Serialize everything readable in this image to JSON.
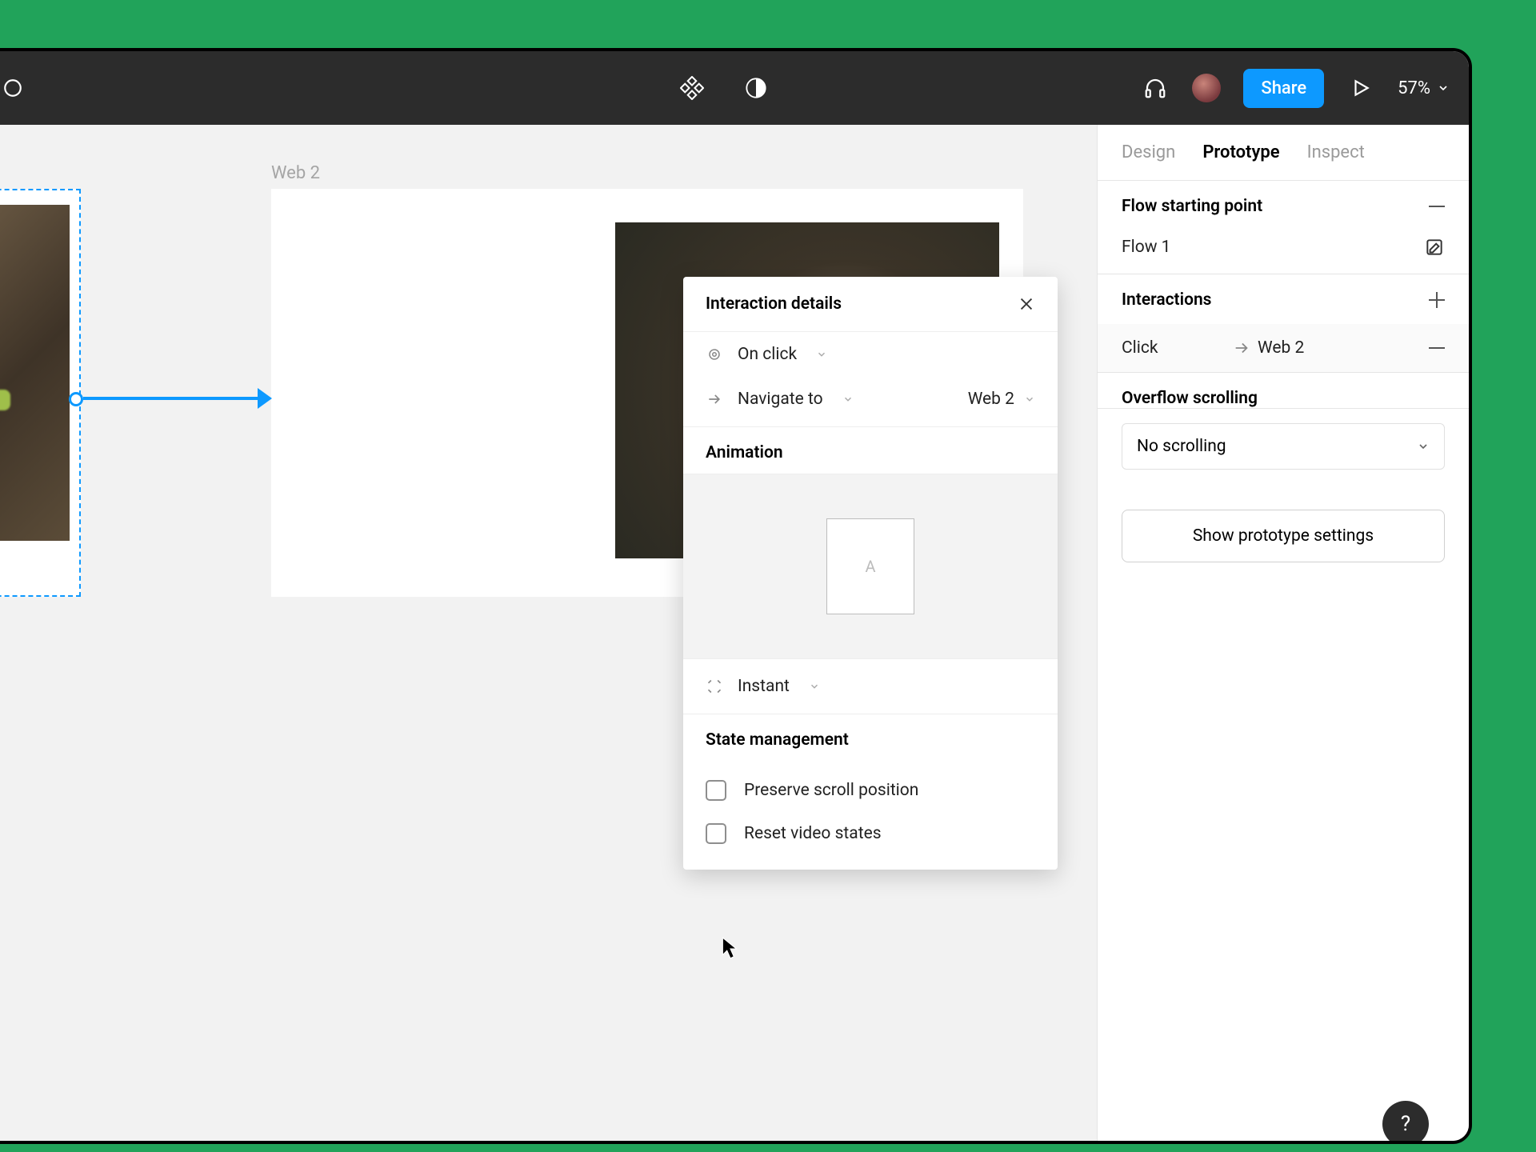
{
  "topbar": {
    "share_label": "Share",
    "zoom": "57%"
  },
  "tabs": {
    "design": "Design",
    "prototype": "Prototype",
    "inspect": "Inspect"
  },
  "flow": {
    "section_title": "Flow starting point",
    "name": "Flow 1"
  },
  "interactions": {
    "section_title": "Interactions",
    "items": [
      {
        "trigger": "Click",
        "destination": "Web 2"
      }
    ]
  },
  "overflow": {
    "section_title": "Overflow scrolling",
    "value": "No scrolling"
  },
  "proto_settings_label": "Show prototype settings",
  "canvas": {
    "frame2_label": "Web 2"
  },
  "popover": {
    "title": "Interaction details",
    "trigger": "On click",
    "action": "Navigate to",
    "destination": "Web 2",
    "animation_label": "Animation",
    "anim_box_letter": "A",
    "transition": "Instant",
    "state_label": "State management",
    "preserve_scroll": "Preserve scroll position",
    "reset_video": "Reset video states"
  },
  "help": "?"
}
